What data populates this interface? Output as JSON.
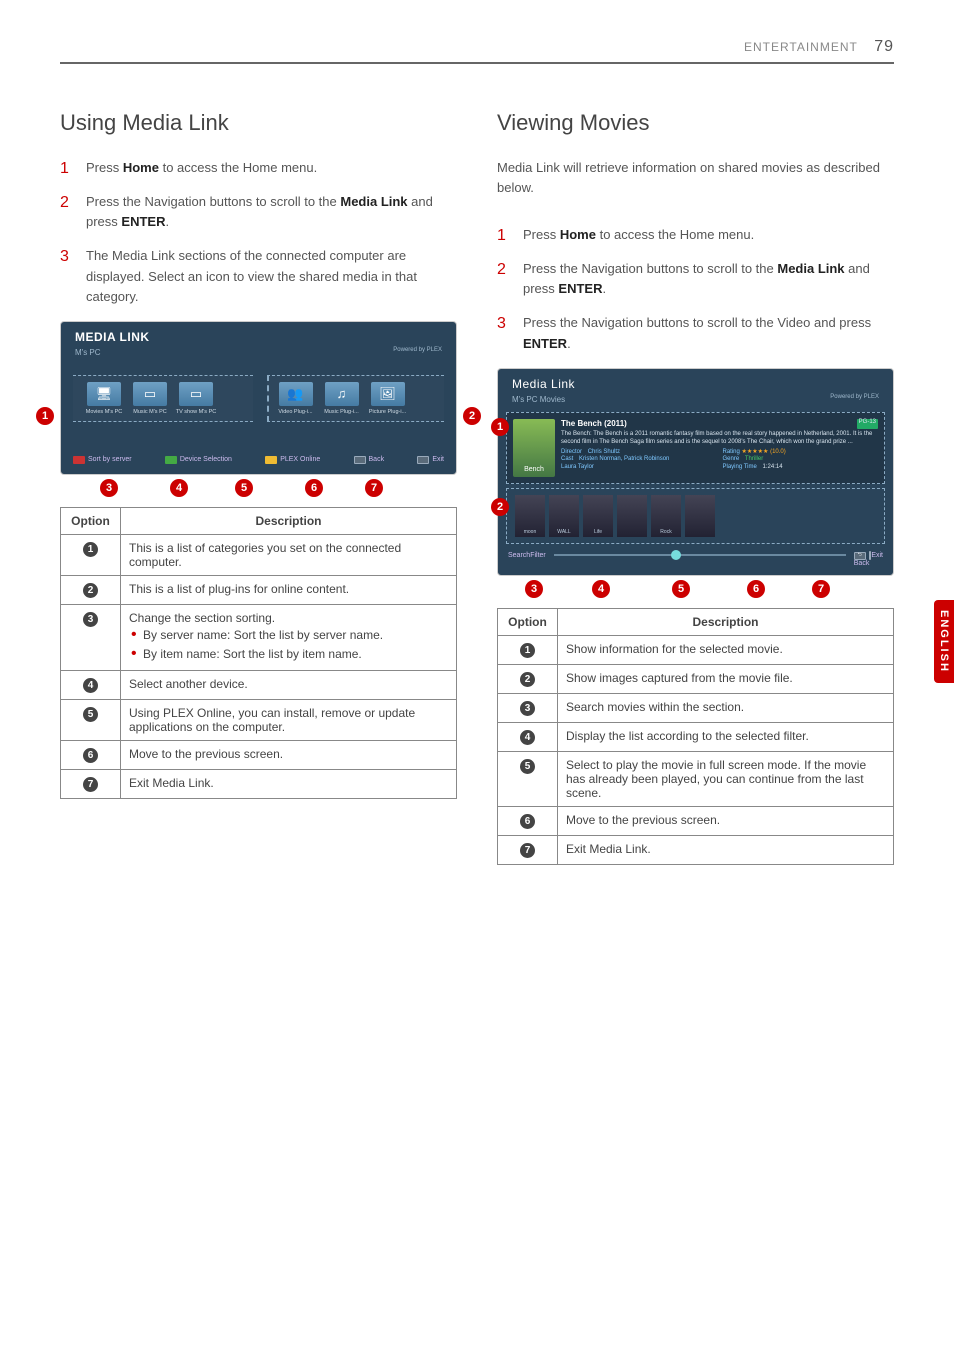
{
  "page_header": {
    "section": "ENTERTAINMENT",
    "page": "79"
  },
  "side_tab": "ENGLISH",
  "left": {
    "heading": "Using Media Link",
    "steps": [
      {
        "pre": "Press ",
        "b1": "Home",
        "post": " to access the Home menu."
      },
      {
        "pre": "Press the Navigation buttons to scroll to the ",
        "b1": "Media Link",
        "mid": " and press ",
        "b2": "ENTER",
        "post": "."
      },
      {
        "plain": "The Media Link sections of the connected computer are displayed. Select an icon to view the shared media in that category."
      }
    ],
    "screenshot": {
      "title": "MEDIA LINK",
      "sub": "M's PC",
      "plex": "Powered by PLEX",
      "cats1": [
        {
          "icon": "🖥",
          "label": "Movies\nM's PC"
        },
        {
          "icon": "▭",
          "label": "Music\nM's PC"
        },
        {
          "icon": "▭",
          "label": "TV show\nM's PC"
        }
      ],
      "cats2": [
        {
          "icon": "👥",
          "label": "Video\nPlug-i..."
        },
        {
          "icon": "♫",
          "label": "Music\nPlug-i..."
        },
        {
          "icon": "🖼",
          "label": "Picture\nPlug-i..."
        }
      ],
      "footer": [
        {
          "color": "red",
          "label": "Sort by server"
        },
        {
          "color": "green",
          "label": "Device Selection"
        },
        {
          "color": "yellow",
          "label": "PLEX Online"
        },
        {
          "color": "back",
          "label": "Back"
        },
        {
          "color": "exit",
          "label": "Exit"
        }
      ]
    },
    "table": {
      "headers": [
        "Option",
        "Description"
      ],
      "rows": [
        {
          "n": "1",
          "desc": "This is a list of categories you set on the connected computer."
        },
        {
          "n": "2",
          "desc": "This is a list of plug-ins for online content."
        },
        {
          "n": "3",
          "desc": "Change the section sorting.",
          "subs": [
            "By server name: Sort the list by server name.",
            "By item name: Sort the list by item name."
          ]
        },
        {
          "n": "4",
          "desc": "Select another device."
        },
        {
          "n": "5",
          "desc": "Using PLEX Online, you can install, remove or update applications on the computer."
        },
        {
          "n": "6",
          "desc": "Move to the previous screen."
        },
        {
          "n": "7",
          "desc": "Exit Media Link."
        }
      ]
    }
  },
  "right": {
    "heading": "Viewing Movies",
    "intro": "Media Link will retrieve information on shared movies as described below.",
    "steps": [
      {
        "pre": "Press ",
        "b1": "Home",
        "post": " to access the Home menu."
      },
      {
        "pre": "Press the Navigation buttons to scroll to the ",
        "b1": "Media Link",
        "mid": " and press ",
        "b2": "ENTER",
        "post": "."
      },
      {
        "pre": "Press the Navigation buttons to scroll to the Video and press ",
        "b1": "ENTER",
        "post": "."
      }
    ],
    "screenshot": {
      "title": "Media Link",
      "sub": "M's PC    Movies",
      "plex": "Powered by PLEX",
      "movie": {
        "poster": "Bench",
        "title": "The Bench (2011)",
        "rating_tag": "PG-13",
        "synopsis": "The Bench: The Bench is a 2011 romantic fantasy film based on the real story happened in Netherland, 2001. It is the second film in The Bench Saga film series and is the sequel to 2008's The Chair, which won the grand prize ...",
        "director_label": "Director",
        "director": "Chris Shultz",
        "cast_label": "Cast",
        "cast": "Kristen Norman, Patrick Robinson\nLaura Taylor",
        "rating_label": "Rating",
        "stars": "★★★★★",
        "score": "(10.0)",
        "genre_label": "Genre",
        "genre": "Thriller",
        "playing_label": "Playing Time",
        "playing": "1:24:14"
      },
      "thumbs": [
        "moon",
        "WALL",
        "Life",
        "",
        "Rock",
        ""
      ],
      "footer": {
        "search": "Search",
        "filter": "Filter",
        "back": "Back",
        "exit": "Exit"
      }
    },
    "table": {
      "headers": [
        "Option",
        "Description"
      ],
      "rows": [
        {
          "n": "1",
          "desc": "Show information for the selected movie."
        },
        {
          "n": "2",
          "desc": "Show images captured from the movie file."
        },
        {
          "n": "3",
          "desc": "Search movies within the section."
        },
        {
          "n": "4",
          "desc": "Display the list according to the selected filter."
        },
        {
          "n": "5",
          "desc": "Select to play the movie in full screen mode. If the movie has already been played, you can continue from the last scene."
        },
        {
          "n": "6",
          "desc": "Move to the previous screen."
        },
        {
          "n": "7",
          "desc": "Exit Media Link."
        }
      ]
    }
  }
}
